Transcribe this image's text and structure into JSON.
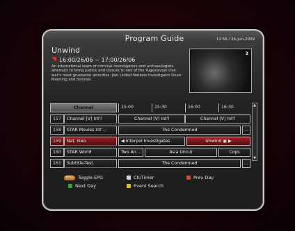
{
  "header": {
    "title": "Program Guide",
    "clock": "12:56 / 26-Jun-2009"
  },
  "program": {
    "name": "Unwind",
    "time": "16:00/26/06 ~ 17:00/26/06",
    "description": "An international team of criminal investigators and archaeologists attempts to bring justice and closure to one of the Yugoslavian civil war's most gruesome atrocities. Join United Nations investigator Dean Manning and forensic"
  },
  "preview": {
    "channel_number": "2"
  },
  "grid": {
    "channel_header": "Channel",
    "time_slots": [
      "15:00",
      "15:30",
      "16:00",
      "16:30"
    ],
    "channels": [
      {
        "number": "157",
        "name": "Channel [V] Int'l"
      },
      {
        "number": "158",
        "name": "STAR Movies Int'..."
      },
      {
        "number": "159",
        "name": "Nat. Geo"
      },
      {
        "number": "160",
        "name": "STAR World"
      },
      {
        "number": "161",
        "name": "Subtitle-Test."
      }
    ],
    "programs": {
      "r157": [
        "Channel [V] Int'l",
        "Channel [V] Int'l"
      ],
      "r158": [
        "The Condemned",
        "..."
      ],
      "r159": [
        "Interpol Investigates",
        "Unwind"
      ],
      "r160": [
        "Two An...",
        "Asia Uncut",
        "Cops"
      ],
      "r161": [
        "The Condemned",
        "..."
      ]
    }
  },
  "footer": {
    "epg_badge": "EPG",
    "toggle_epg": "Toggle EPG",
    "ch_timer": "Ch/Timer",
    "prev_day": "Prev Day",
    "next_day": "Next Day",
    "event_search": "Event Search"
  },
  "colors": {
    "accent": "#9a2226",
    "frame": "#c9c9c9"
  }
}
